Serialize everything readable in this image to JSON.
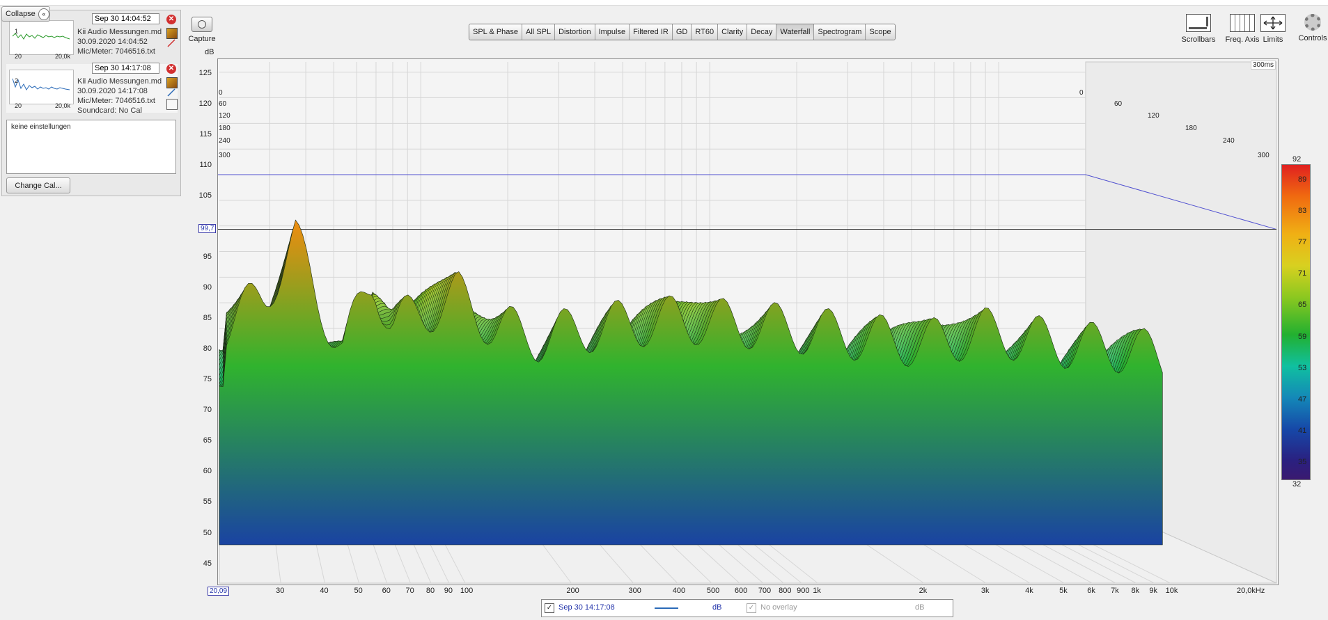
{
  "window": {
    "background": "#f0f0f0"
  },
  "left_panel": {
    "collapse_label": "Collapse",
    "measurements": [
      {
        "index": "1",
        "date": "Sep 30 14:04:52",
        "name": "Kii Audio Messungen.md",
        "datetime": "30.09.2020 14:04:52",
        "mic": "Mic/Meter: 7046516.txt",
        "thumb_left": "20",
        "thumb_right": "20,0k",
        "trace_color": "#2a9a2a"
      },
      {
        "index": "2",
        "date": "Sep 30 14:17:08",
        "name": "Kii Audio Messungen.md",
        "datetime": "30.09.2020 14:17:08",
        "mic": "Mic/Meter: 7046516.txt",
        "soundcard": "Soundcard: No Cal",
        "thumb_left": "20",
        "thumb_right": "20,0k",
        "trace_color": "#2a6ab8"
      }
    ],
    "notes": "keine einstellungen",
    "change_cal_label": "Change Cal..."
  },
  "capture": {
    "label": "Capture"
  },
  "tabs": [
    {
      "label": "SPL & Phase",
      "active": false
    },
    {
      "label": "All SPL",
      "active": false
    },
    {
      "label": "Distortion",
      "active": false
    },
    {
      "label": "Impulse",
      "active": false
    },
    {
      "label": "Filtered IR",
      "active": false
    },
    {
      "label": "GD",
      "active": false
    },
    {
      "label": "RT60",
      "active": false
    },
    {
      "label": "Clarity",
      "active": false
    },
    {
      "label": "Decay",
      "active": false
    },
    {
      "label": "Waterfall",
      "active": true
    },
    {
      "label": "Spectrogram",
      "active": false
    },
    {
      "label": "Scope",
      "active": false
    }
  ],
  "tools": [
    {
      "label": "Scrollbars",
      "icon": "scrollbars-icon"
    },
    {
      "label": "Freq. Axis",
      "icon": "freq-axis-icon"
    },
    {
      "label": "Limits",
      "icon": "limits-icon"
    },
    {
      "label": "Controls",
      "icon": "gear-icon"
    }
  ],
  "chart_data": {
    "type": "waterfall",
    "ylabel": "dB",
    "y_ticks": [
      "125",
      "120",
      "115",
      "110",
      "105",
      "95",
      "90",
      "85",
      "80",
      "75",
      "70",
      "65",
      "60",
      "55",
      "50",
      "45"
    ],
    "ylim": [
      42,
      127
    ],
    "y_cursor_label": "99,7",
    "x_start_label": "20,09",
    "x_end_label": "20,0kHz",
    "x_ticks": [
      "30",
      "40",
      "50",
      "60",
      "70",
      "80",
      "90",
      "100",
      "200",
      "300",
      "400",
      "500",
      "600",
      "700",
      "800",
      "900",
      "1k",
      "2k",
      "3k",
      "4k",
      "5k",
      "6k",
      "7k",
      "8k",
      "9k",
      "10k"
    ],
    "x_range_hz": [
      20.09,
      20000
    ],
    "time_ticks_ms": [
      "0",
      "60",
      "120",
      "180",
      "240",
      "300"
    ],
    "time_left_ticks": [
      "0",
      "60",
      "120",
      "180",
      "240",
      "300"
    ],
    "time_end_label": "300ms",
    "color_scale": {
      "max_label": "92",
      "min_label": "32",
      "ticks": [
        "89",
        "83",
        "77",
        "71",
        "65",
        "59",
        "53",
        "47",
        "41",
        "35"
      ],
      "range": [
        32,
        92
      ]
    },
    "reference_line_db": 105,
    "cursor_db": 99.7,
    "front_slice_peaks": [
      {
        "hz": 21,
        "db": 84
      },
      {
        "hz": 27,
        "db": 89
      },
      {
        "hz": 33,
        "db": 98
      },
      {
        "hz": 38,
        "db": 89
      },
      {
        "hz": 45,
        "db": 80
      },
      {
        "hz": 55,
        "db": 92
      },
      {
        "hz": 62,
        "db": 84
      },
      {
        "hz": 75,
        "db": 86
      },
      {
        "hz": 95,
        "db": 89
      },
      {
        "hz": 120,
        "db": 84
      },
      {
        "hz": 160,
        "db": 82
      },
      {
        "hz": 250,
        "db": 84
      },
      {
        "hz": 400,
        "db": 85
      },
      {
        "hz": 700,
        "db": 84
      },
      {
        "hz": 1000,
        "db": 83
      },
      {
        "hz": 2000,
        "db": 81
      },
      {
        "hz": 3000,
        "db": 83
      },
      {
        "hz": 5000,
        "db": 81
      },
      {
        "hz": 8000,
        "db": 80
      },
      {
        "hz": 10000,
        "db": 78
      }
    ]
  },
  "legend": {
    "series1": {
      "label": "Sep 30 14:17:08",
      "unit": "dB",
      "checked": true,
      "color": "#2a6ab8"
    },
    "series2": {
      "label": "No overlay",
      "unit": "dB",
      "checked": true
    }
  }
}
